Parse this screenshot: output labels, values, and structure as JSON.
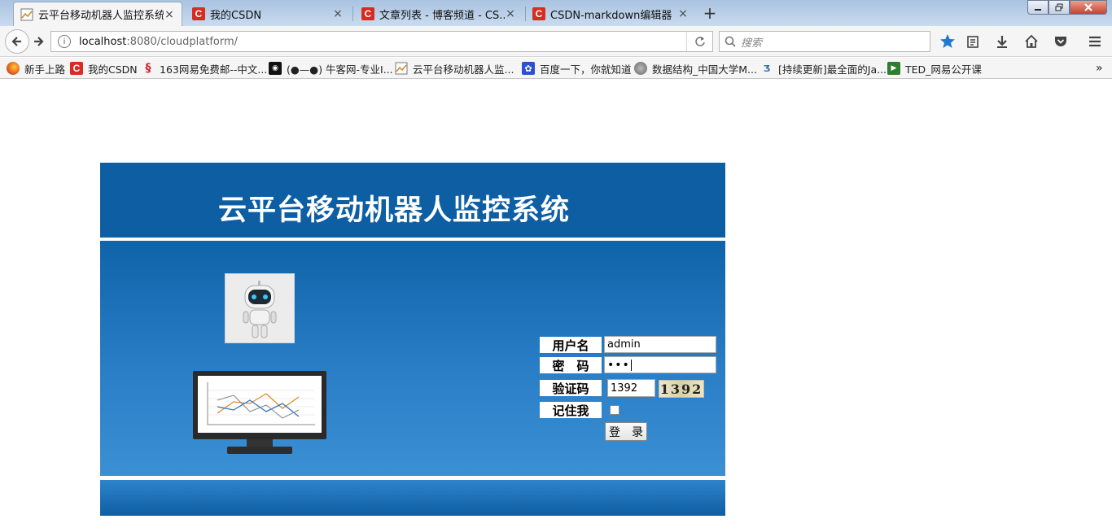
{
  "tabs": [
    {
      "title": "云平台移动机器人监控系统",
      "active": true
    },
    {
      "title": "我的CSDN",
      "active": false
    },
    {
      "title": "文章列表 - 博客频道 - CS...",
      "active": false
    },
    {
      "title": "CSDN-markdown编辑器",
      "active": false
    }
  ],
  "tab_icon_letter": "C",
  "new_tab_symbol": "+",
  "close_symbol": "×",
  "address": {
    "host": "localhost",
    "path": ":8080/cloudplatform/"
  },
  "search": {
    "placeholder": "搜索"
  },
  "bookmarks": [
    {
      "label": "新手上路"
    },
    {
      "label": "我的CSDN"
    },
    {
      "label": "163网易免费邮--中文..."
    },
    {
      "label": "(●—●) 牛客网-专业I..."
    },
    {
      "label": "云平台移动机器人监..."
    },
    {
      "label": "百度一下，你就知道"
    },
    {
      "label": "数据结构_中国大学M..."
    },
    {
      "label": "[持续更新]最全面的Ja..."
    },
    {
      "label": "TED_网易公开课"
    }
  ],
  "bookmarks_overflow": "»",
  "page": {
    "title": "云平台移动机器人监控系统",
    "username_label": "用户名",
    "password_label": "密　码",
    "captcha_label": "验证码",
    "remember_label": "记住我",
    "username_value": "admin",
    "password_value": "•••",
    "captcha_value": "1392",
    "captcha_image_text": "1392",
    "login_button": "登　录"
  },
  "colors": {
    "header": "#0d5ea3",
    "main_gradient_bottom": "#3b8fd3",
    "csdn_red": "#d92b1f"
  }
}
